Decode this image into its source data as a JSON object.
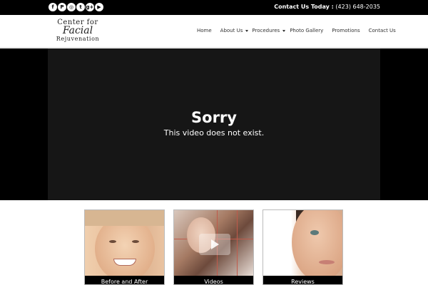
{
  "topbar": {
    "social_icons": [
      {
        "name": "facebook-icon",
        "glyph": "f"
      },
      {
        "name": "pinterest-icon",
        "glyph": "P"
      },
      {
        "name": "instagram-icon",
        "glyph": "◎"
      },
      {
        "name": "twitter-icon",
        "glyph": "t"
      },
      {
        "name": "google-plus-icon",
        "glyph": "g+"
      },
      {
        "name": "youtube-icon",
        "glyph": "▶"
      }
    ],
    "contact_label": "Contact Us Today :",
    "phone": "(423) 648-2035"
  },
  "header": {
    "logo": {
      "line1": "Center for",
      "line2": "Facial",
      "line3": "Rejuvenation"
    },
    "nav": [
      {
        "label": "Home",
        "has_dropdown": false
      },
      {
        "label": "About Us",
        "has_dropdown": true
      },
      {
        "label": "Procedures",
        "has_dropdown": true
      },
      {
        "label": "Photo Gallery",
        "has_dropdown": false
      },
      {
        "label": "Promotions",
        "has_dropdown": false
      },
      {
        "label": "Contact Us",
        "has_dropdown": false
      }
    ]
  },
  "video": {
    "title": "Sorry",
    "message": "This video does not exist."
  },
  "cards": [
    {
      "label": "Before and After"
    },
    {
      "label": "Videos"
    },
    {
      "label": "Reviews"
    }
  ],
  "colors": {
    "topbar": "#000000",
    "video_bg": "#161616",
    "caption_bg": "#000000"
  }
}
